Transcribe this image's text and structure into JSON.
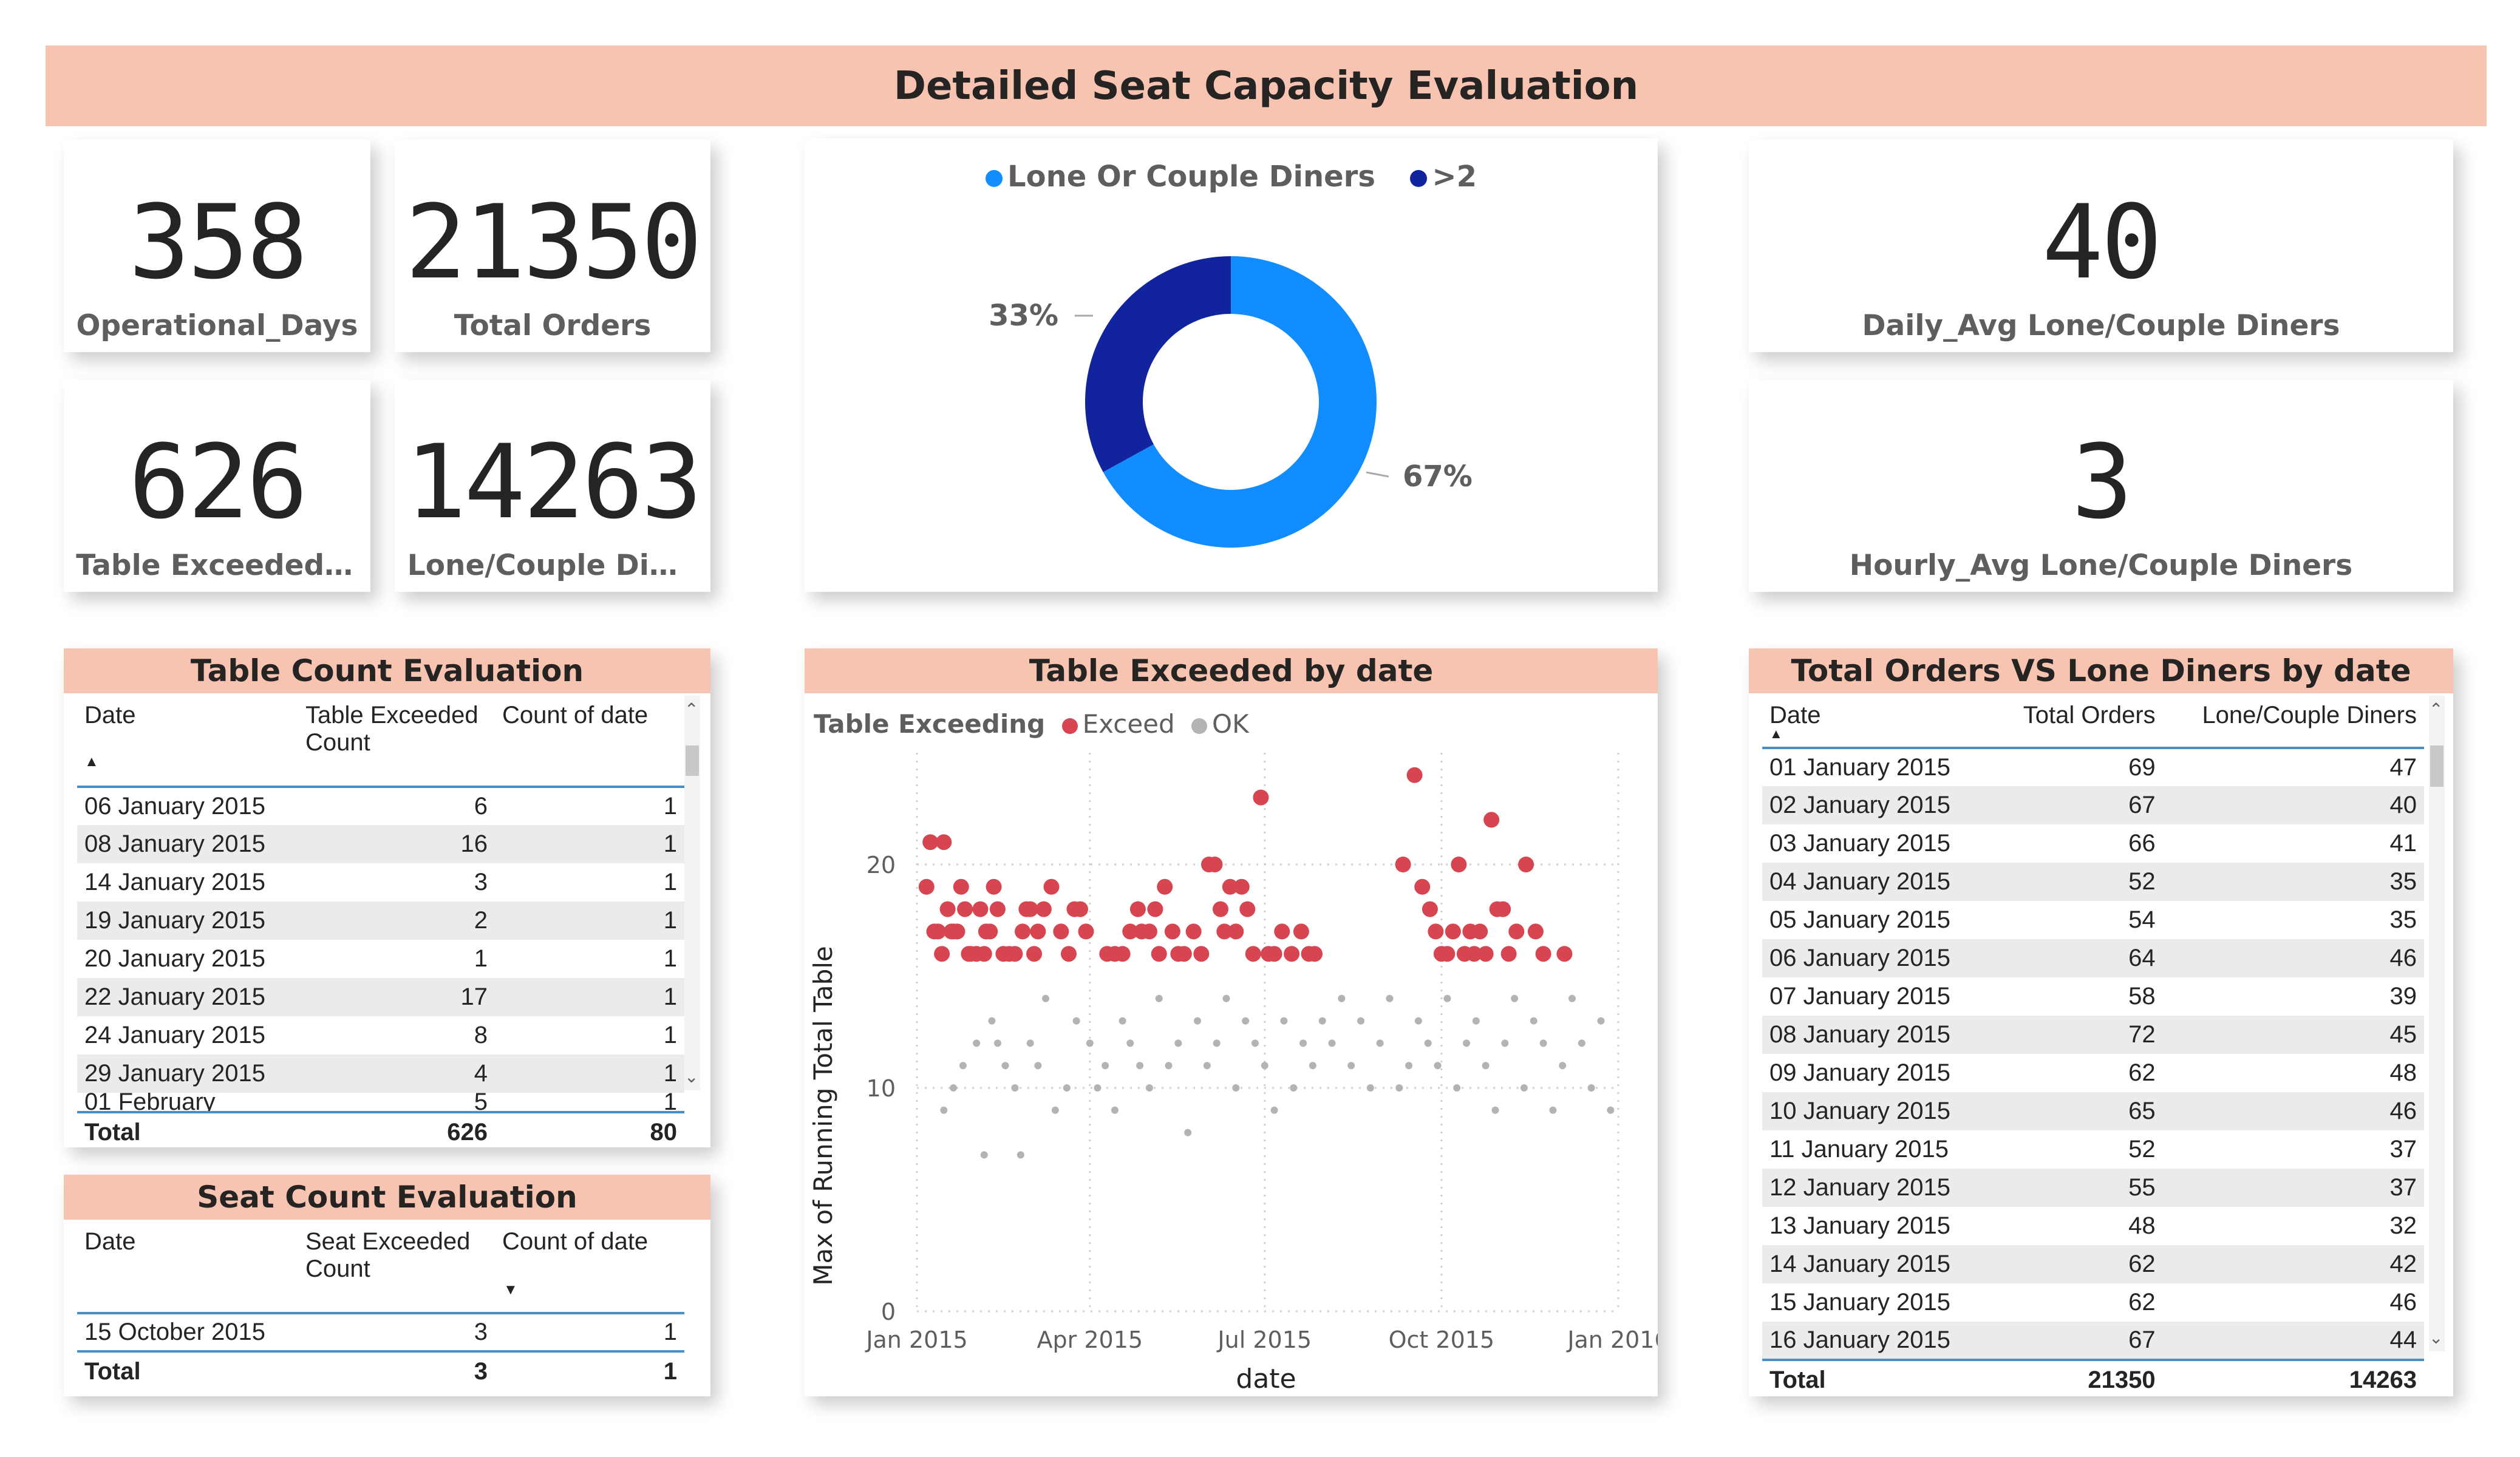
{
  "banner": {
    "title": "Detailed Seat Capacity Evaluation"
  },
  "kpis": {
    "operational_days": {
      "value": "358",
      "label": "Operational_Days"
    },
    "total_orders": {
      "value": "21350",
      "label": "Total Orders"
    },
    "table_exceeded": {
      "value": "626",
      "label": "Table Exceeded C..."
    },
    "lone_couple": {
      "value": "14263",
      "label": "Lone/Couple Diners"
    },
    "daily_avg": {
      "value": "40",
      "label": "Daily_Avg Lone/Couple Diners"
    },
    "hourly_avg": {
      "value": "3",
      "label": "Hourly_Avg Lone/Couple Diners"
    }
  },
  "donut": {
    "legend": [
      {
        "name": "Lone Or Couple Diners",
        "color": "#118dff"
      },
      {
        "name": ">2",
        "color": "#12239e"
      }
    ],
    "chart_data": {
      "type": "pie",
      "categories": [
        "Lone Or Couple Diners",
        ">2"
      ],
      "values": [
        67,
        33
      ],
      "labels": [
        "67%",
        "33%"
      ]
    }
  },
  "table_count": {
    "title": "Table Count Evaluation",
    "columns": [
      "Date",
      "Table Exceeded Count",
      "Count of date"
    ],
    "rows": [
      [
        "06 January 2015",
        "6",
        "1"
      ],
      [
        "08 January 2015",
        "16",
        "1"
      ],
      [
        "14 January 2015",
        "3",
        "1"
      ],
      [
        "19 January 2015",
        "2",
        "1"
      ],
      [
        "20 January 2015",
        "1",
        "1"
      ],
      [
        "22 January 2015",
        "17",
        "1"
      ],
      [
        "24 January 2015",
        "8",
        "1"
      ],
      [
        "29 January 2015",
        "4",
        "1"
      ],
      [
        "01 February",
        "5",
        "1"
      ]
    ],
    "total": [
      "Total",
      "626",
      "80"
    ]
  },
  "seat_count": {
    "title": "Seat Count Evaluation",
    "columns": [
      "Date",
      "Seat Exceeded Count",
      "Count of date"
    ],
    "rows": [
      [
        "15 October 2015",
        "3",
        "1"
      ]
    ],
    "total": [
      "Total",
      "3",
      "1"
    ]
  },
  "scatter": {
    "title": "Table Exceeded by date",
    "legend_title": "Table Exceeding",
    "legend": [
      {
        "name": "Exceed",
        "color": "#d64550"
      },
      {
        "name": "OK",
        "color": "#b3b3b3"
      }
    ],
    "chart_data": {
      "type": "scatter",
      "xlabel": "date",
      "ylabel": "Max of Running Total Table",
      "xticks": [
        "Jan 2015",
        "Apr 2015",
        "Jul 2015",
        "Oct 2015",
        "Jan 2016"
      ],
      "yticks": [
        "0",
        "10",
        "20"
      ],
      "ylim": [
        0,
        25
      ],
      "xlim": [
        "2015-01-01",
        "2016-01-01"
      ],
      "series": [
        {
          "name": "Exceed",
          "points": [
            [
              "2015-01-06",
              19
            ],
            [
              "2015-01-08",
              21
            ],
            [
              "2015-01-10",
              17
            ],
            [
              "2015-01-12",
              17
            ],
            [
              "2015-01-14",
              16
            ],
            [
              "2015-01-15",
              21
            ],
            [
              "2015-01-17",
              18
            ],
            [
              "2015-01-19",
              17
            ],
            [
              "2015-01-20",
              17
            ],
            [
              "2015-01-22",
              17
            ],
            [
              "2015-01-24",
              19
            ],
            [
              "2015-01-26",
              18
            ],
            [
              "2015-01-28",
              16
            ],
            [
              "2015-01-29",
              16
            ],
            [
              "2015-02-01",
              16
            ],
            [
              "2015-02-03",
              18
            ],
            [
              "2015-02-05",
              16
            ],
            [
              "2015-02-06",
              17
            ],
            [
              "2015-02-08",
              17
            ],
            [
              "2015-02-10",
              19
            ],
            [
              "2015-02-12",
              18
            ],
            [
              "2015-02-15",
              16
            ],
            [
              "2015-02-18",
              16
            ],
            [
              "2015-02-21",
              16
            ],
            [
              "2015-02-25",
              17
            ],
            [
              "2015-02-27",
              18
            ],
            [
              "2015-03-01",
              18
            ],
            [
              "2015-03-03",
              16
            ],
            [
              "2015-03-05",
              17
            ],
            [
              "2015-03-08",
              18
            ],
            [
              "2015-03-12",
              19
            ],
            [
              "2015-03-17",
              17
            ],
            [
              "2015-03-21",
              16
            ],
            [
              "2015-03-24",
              18
            ],
            [
              "2015-03-27",
              18
            ],
            [
              "2015-03-30",
              17
            ],
            [
              "2015-04-10",
              16
            ],
            [
              "2015-04-14",
              16
            ],
            [
              "2015-04-18",
              16
            ],
            [
              "2015-04-22",
              17
            ],
            [
              "2015-04-26",
              18
            ],
            [
              "2015-04-28",
              17
            ],
            [
              "2015-05-02",
              17
            ],
            [
              "2015-05-05",
              18
            ],
            [
              "2015-05-07",
              16
            ],
            [
              "2015-05-10",
              19
            ],
            [
              "2015-05-14",
              17
            ],
            [
              "2015-05-17",
              16
            ],
            [
              "2015-05-20",
              16
            ],
            [
              "2015-05-25",
              17
            ],
            [
              "2015-05-29",
              16
            ],
            [
              "2015-06-02",
              20
            ],
            [
              "2015-06-05",
              20
            ],
            [
              "2015-06-08",
              18
            ],
            [
              "2015-06-10",
              17
            ],
            [
              "2015-06-13",
              19
            ],
            [
              "2015-06-16",
              17
            ],
            [
              "2015-06-19",
              19
            ],
            [
              "2015-06-22",
              18
            ],
            [
              "2015-06-25",
              16
            ],
            [
              "2015-06-29",
              23
            ],
            [
              "2015-07-03",
              16
            ],
            [
              "2015-07-06",
              16
            ],
            [
              "2015-07-10",
              17
            ],
            [
              "2015-07-15",
              16
            ],
            [
              "2015-07-20",
              17
            ],
            [
              "2015-07-24",
              16
            ],
            [
              "2015-07-27",
              16
            ],
            [
              "2015-09-11",
              20
            ],
            [
              "2015-09-17",
              24
            ],
            [
              "2015-09-21",
              19
            ],
            [
              "2015-09-25",
              18
            ],
            [
              "2015-09-28",
              17
            ],
            [
              "2015-10-01",
              16
            ],
            [
              "2015-10-04",
              16
            ],
            [
              "2015-10-07",
              17
            ],
            [
              "2015-10-10",
              20
            ],
            [
              "2015-10-13",
              16
            ],
            [
              "2015-10-16",
              17
            ],
            [
              "2015-10-18",
              16
            ],
            [
              "2015-10-21",
              17
            ],
            [
              "2015-10-24",
              16
            ],
            [
              "2015-10-27",
              22
            ],
            [
              "2015-10-30",
              18
            ],
            [
              "2015-11-02",
              18
            ],
            [
              "2015-11-05",
              16
            ],
            [
              "2015-11-09",
              17
            ],
            [
              "2015-11-14",
              20
            ],
            [
              "2015-11-19",
              17
            ],
            [
              "2015-11-23",
              16
            ],
            [
              "2015-12-04",
              16
            ]
          ]
        },
        {
          "name": "OK",
          "points": [
            [
              "2015-01-15",
              9
            ],
            [
              "2015-01-20",
              10
            ],
            [
              "2015-01-25",
              11
            ],
            [
              "2015-02-01",
              12
            ],
            [
              "2015-02-05",
              7
            ],
            [
              "2015-02-09",
              13
            ],
            [
              "2015-02-12",
              12
            ],
            [
              "2015-02-16",
              11
            ],
            [
              "2015-02-21",
              10
            ],
            [
              "2015-02-24",
              7
            ],
            [
              "2015-03-01",
              12
            ],
            [
              "2015-03-05",
              11
            ],
            [
              "2015-03-09",
              14
            ],
            [
              "2015-03-14",
              9
            ],
            [
              "2015-03-20",
              10
            ],
            [
              "2015-03-25",
              13
            ],
            [
              "2015-04-01",
              12
            ],
            [
              "2015-04-05",
              10
            ],
            [
              "2015-04-09",
              11
            ],
            [
              "2015-04-14",
              9
            ],
            [
              "2015-04-18",
              13
            ],
            [
              "2015-04-22",
              12
            ],
            [
              "2015-04-27",
              11
            ],
            [
              "2015-05-02",
              10
            ],
            [
              "2015-05-07",
              14
            ],
            [
              "2015-05-12",
              11
            ],
            [
              "2015-05-17",
              12
            ],
            [
              "2015-05-22",
              8
            ],
            [
              "2015-05-27",
              13
            ],
            [
              "2015-06-01",
              11
            ],
            [
              "2015-06-06",
              12
            ],
            [
              "2015-06-11",
              14
            ],
            [
              "2015-06-16",
              10
            ],
            [
              "2015-06-21",
              13
            ],
            [
              "2015-06-26",
              12
            ],
            [
              "2015-07-01",
              11
            ],
            [
              "2015-07-06",
              9
            ],
            [
              "2015-07-11",
              13
            ],
            [
              "2015-07-16",
              10
            ],
            [
              "2015-07-21",
              12
            ],
            [
              "2015-07-26",
              11
            ],
            [
              "2015-07-31",
              13
            ],
            [
              "2015-08-05",
              12
            ],
            [
              "2015-08-10",
              14
            ],
            [
              "2015-08-15",
              11
            ],
            [
              "2015-08-20",
              13
            ],
            [
              "2015-08-25",
              10
            ],
            [
              "2015-08-30",
              12
            ],
            [
              "2015-09-04",
              14
            ],
            [
              "2015-09-09",
              10
            ],
            [
              "2015-09-14",
              11
            ],
            [
              "2015-09-19",
              13
            ],
            [
              "2015-09-24",
              12
            ],
            [
              "2015-09-29",
              11
            ],
            [
              "2015-10-04",
              14
            ],
            [
              "2015-10-09",
              10
            ],
            [
              "2015-10-14",
              12
            ],
            [
              "2015-10-19",
              13
            ],
            [
              "2015-10-24",
              11
            ],
            [
              "2015-10-29",
              9
            ],
            [
              "2015-11-03",
              12
            ],
            [
              "2015-11-08",
              14
            ],
            [
              "2015-11-13",
              10
            ],
            [
              "2015-11-18",
              13
            ],
            [
              "2015-11-23",
              12
            ],
            [
              "2015-11-28",
              9
            ],
            [
              "2015-12-03",
              11
            ],
            [
              "2015-12-08",
              14
            ],
            [
              "2015-12-13",
              12
            ],
            [
              "2015-12-18",
              10
            ],
            [
              "2015-12-23",
              13
            ],
            [
              "2015-12-28",
              9
            ]
          ]
        }
      ]
    }
  },
  "orders_table": {
    "title": "Total Orders VS Lone Diners by date",
    "columns": [
      "Date",
      "Total Orders",
      "Lone/Couple Diners"
    ],
    "rows": [
      [
        "01 January 2015",
        "69",
        "47"
      ],
      [
        "02 January 2015",
        "67",
        "40"
      ],
      [
        "03 January 2015",
        "66",
        "41"
      ],
      [
        "04 January 2015",
        "52",
        "35"
      ],
      [
        "05 January 2015",
        "54",
        "35"
      ],
      [
        "06 January 2015",
        "64",
        "46"
      ],
      [
        "07 January 2015",
        "58",
        "39"
      ],
      [
        "08 January 2015",
        "72",
        "45"
      ],
      [
        "09 January 2015",
        "62",
        "48"
      ],
      [
        "10 January 2015",
        "65",
        "46"
      ],
      [
        "11 January 2015",
        "52",
        "37"
      ],
      [
        "12 January 2015",
        "55",
        "37"
      ],
      [
        "13 January 2015",
        "48",
        "32"
      ],
      [
        "14 January 2015",
        "62",
        "42"
      ],
      [
        "15 January 2015",
        "62",
        "46"
      ],
      [
        "16 January 2015",
        "67",
        "44"
      ]
    ],
    "total": [
      "Total",
      "21350",
      "14263"
    ]
  }
}
